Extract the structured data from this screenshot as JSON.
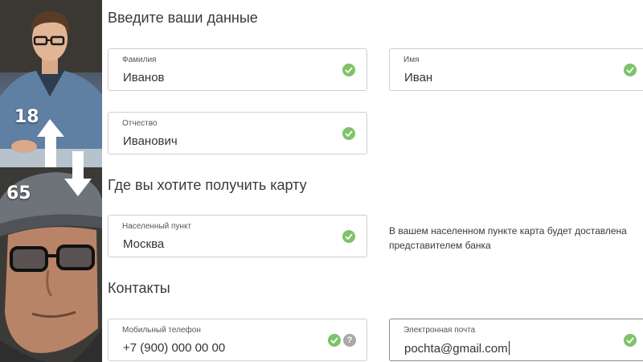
{
  "photos": {
    "young_age": "18",
    "old_age": "65"
  },
  "sections": {
    "personal": "Введите ваши данные",
    "location": "Где вы хотите получить карту",
    "contacts": "Контакты"
  },
  "fields": {
    "surname": {
      "label": "Фамилия",
      "value": "Иванов"
    },
    "name": {
      "label": "Имя",
      "value": "Иван"
    },
    "patronymic": {
      "label": "Отчество",
      "value": "Иванович"
    },
    "city": {
      "label": "Населенный пункт",
      "value": "Москва"
    },
    "phone": {
      "label": "Мобильный телефон",
      "value": "+7 (900) 000 00 00"
    },
    "email": {
      "label": "Электронная почта",
      "value": "pochta@gmail.com"
    }
  },
  "info": {
    "delivery": "В вашем населенном пункте карта будет доставлена представителем банка"
  },
  "help_icon": "?",
  "colors": {
    "valid_check": "#7ec36a",
    "help_icon": "#a9a9a9",
    "field_border": "#cfcfcf"
  },
  "icons": [
    "check-icon",
    "help-icon",
    "arrow-up-icon",
    "arrow-down-icon"
  ]
}
